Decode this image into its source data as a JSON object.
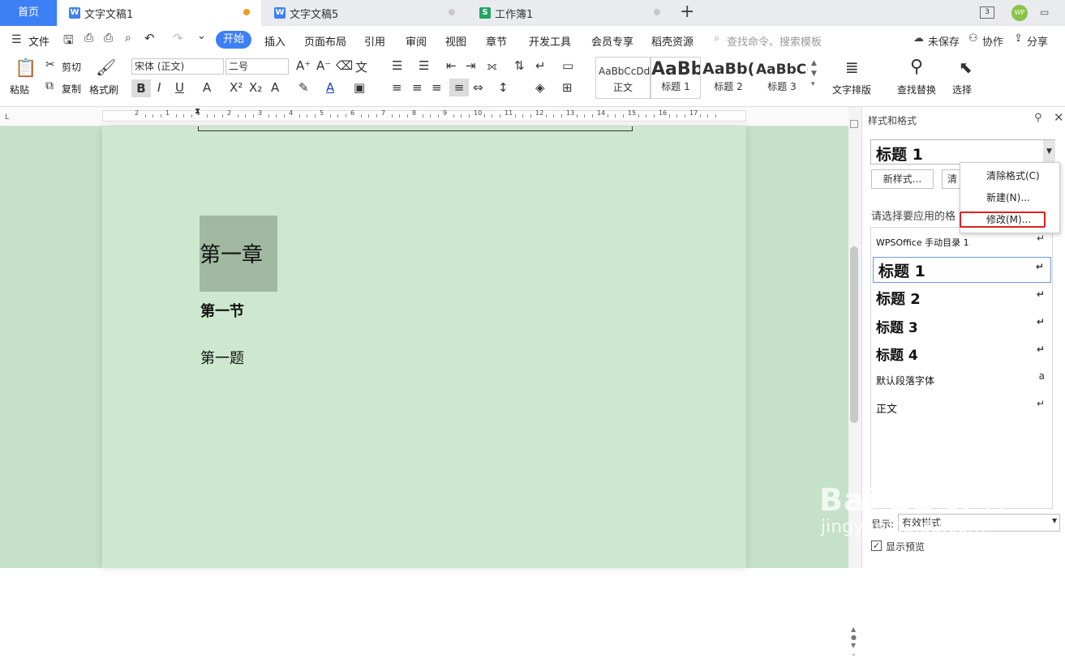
{
  "tabs": {
    "home": "首页",
    "doc1": "文字文稿1",
    "doc5": "文字文稿5",
    "book1": "工作簿1",
    "new": "+"
  },
  "menu": {
    "file": "文件",
    "items": [
      "开始",
      "插入",
      "页面布局",
      "引用",
      "审阅",
      "视图",
      "章节",
      "开发工具",
      "会员专享",
      "稻壳资源"
    ],
    "search": "查找命令、搜索模板",
    "unsaved": "未保存",
    "collab": "协作",
    "share": "分享"
  },
  "ribbon": {
    "paste": "粘贴",
    "cut": "剪切",
    "copy": "复制",
    "format_painter": "格式刷",
    "font": "宋体 (正文)",
    "size": "二号",
    "styles": [
      {
        "preview": "AaBbCcDd",
        "name": "正文"
      },
      {
        "preview": "AaBb",
        "name": "标题 1"
      },
      {
        "preview": "AaBb(",
        "name": "标题 2"
      },
      {
        "preview": "AaBbC(",
        "name": "标题 3"
      }
    ],
    "text_layout": "文字排版",
    "find_replace": "查找替换",
    "select": "选择"
  },
  "ruler": {
    "ticks": [
      "2",
      "1",
      "1",
      "2",
      "3",
      "4",
      "5",
      "6",
      "7",
      "8",
      "9",
      "10",
      "11",
      "12",
      "13",
      "14",
      "15",
      "16",
      "17"
    ]
  },
  "document": {
    "h1": "第一章",
    "h2": "第一节",
    "h3": "第一题"
  },
  "panel": {
    "title": "样式和格式",
    "current": "标题 1",
    "new_style": "新样式...",
    "clear_btn": "清",
    "prompt": "请选择要应用的格",
    "styles": [
      {
        "label": "WPSOffice 手动目录 1",
        "ret": "↵"
      },
      {
        "label": "标题 1",
        "ret": "↵"
      },
      {
        "label": "标题 2",
        "ret": "↵"
      },
      {
        "label": "标题 3",
        "ret": "↵"
      },
      {
        "label": "标题 4",
        "ret": "↵"
      },
      {
        "label": "默认段落字体",
        "ret": "a"
      },
      {
        "label": "正文",
        "ret": "↵"
      }
    ],
    "show_label": "显示:",
    "show_value": "有效样式",
    "preview_label": "显示预览"
  },
  "dropdown": {
    "clear": "清除格式(C)",
    "new": "新建(N)...",
    "modify": "修改(M)..."
  },
  "colors": {
    "accent": "#3d7ff5",
    "page": "#cde8ce",
    "highlight": "#e02020"
  },
  "watermark": {
    "text": "Bai du 经验",
    "url": "jingyan.baidu.com"
  }
}
